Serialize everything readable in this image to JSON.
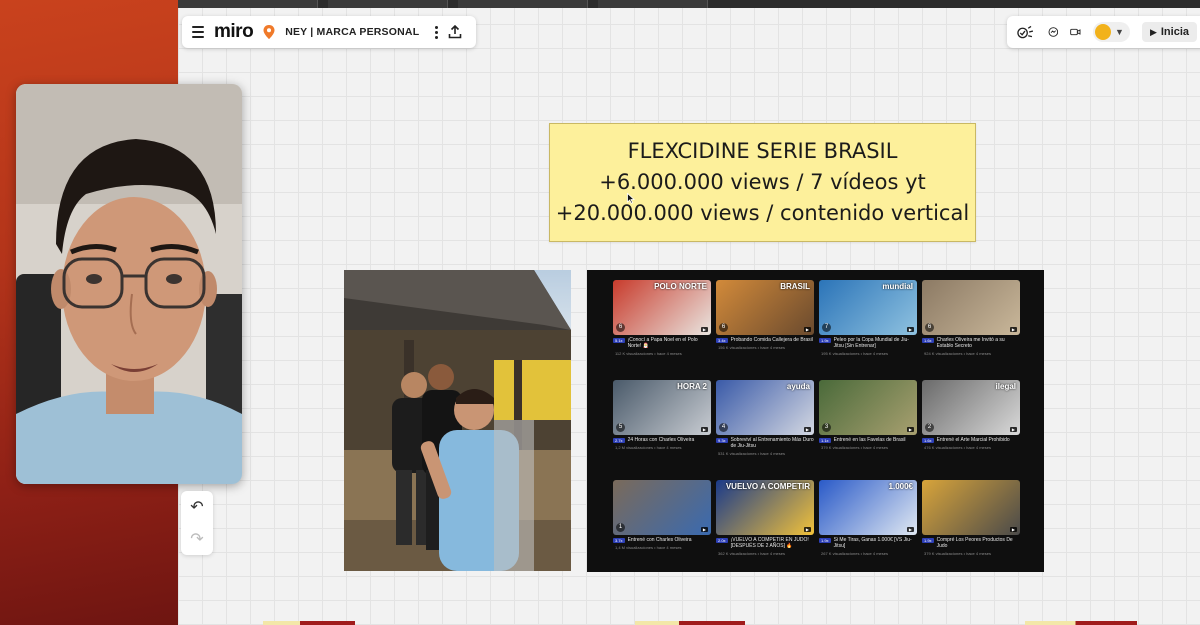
{
  "toolbar": {
    "logo": "miro",
    "board_name": "NEY | MARCA PERSONAL",
    "icons": [
      "menu-icon",
      "location-pin-icon",
      "more-vertical-icon",
      "upload-icon"
    ]
  },
  "right_toolbar": {
    "start_label": "Inicia",
    "icons": [
      "reactions-icon",
      "chat-icon",
      "video-icon",
      "collaborator-avatar",
      "chevron-down-icon",
      "play-icon"
    ],
    "avatar_color": "#f2b21b"
  },
  "sticky": {
    "line1": "FLEXCIDINE SERIE BRASIL",
    "line2": "+6.000.000 views / 7 vídeos yt",
    "line3": "+20.000.000 views / contenido vertical",
    "color": "#fdf09b"
  },
  "videos": [
    {
      "badge": "5.1x",
      "title": "¡Conocí a Papa Noel en el Polo Norte! 🎅",
      "sub": "112 K visualizaciones • hace 4 meses",
      "word": "POLO NORTE",
      "num": "6"
    },
    {
      "badge": "3.4x",
      "title": "Probando Comida Callejera de Brasil",
      "sub": "156 K visualizaciones • hace 4 meses",
      "word": "BRASIL",
      "num": "6"
    },
    {
      "badge": "1.9x",
      "title": "Peleo por la Copa Mundial de Jiu-Jitsu [Sin Entrenar]",
      "sub": "195 K visualizaciones • hace 4 meses",
      "word": "mundial",
      "num": "7"
    },
    {
      "badge": "1.6x",
      "title": "Charles Oliveira me Invitó a su Establo Secreto",
      "sub": "924 K visualizaciones • hace 4 meses",
      "word": "",
      "num": "6"
    },
    {
      "badge": "2.7x",
      "title": "24 Horas con Charles Oliveira",
      "sub": "1,2 M visualizaciones • hace 4 meses",
      "word": "HORA 2",
      "num": "5"
    },
    {
      "badge": "9.3x",
      "title": "Sobreviví al Entrenamiento Más Duro de Jiu-Jitsu",
      "sub": "531 K visualizaciones • hace 4 meses",
      "word": "ayuda",
      "num": "4"
    },
    {
      "badge": "1.1x",
      "title": "Entrené en las Favelas de Brasil",
      "sub": "379 K visualizaciones • hace 4 meses",
      "word": "",
      "num": "3"
    },
    {
      "badge": "1.6x",
      "title": "Entrené el Arte Marcial Prohibido",
      "sub": "476 K visualizaciones • hace 4 meses",
      "word": "ilegal",
      "num": "2"
    },
    {
      "badge": "3.7x",
      "title": "Entrené con Charles Oliveira",
      "sub": "1,4 M visualizaciones • hace 4 meses",
      "word": "",
      "num": "1"
    },
    {
      "badge": "2.0x",
      "title": "¡VUELVO A COMPETIR EN JUDO! [DESPUÉS DE 2 AÑOS] 🔥",
      "sub": "362 K visualizaciones • hace 4 meses",
      "word": "VUELVO A COMPETIR",
      "num": ""
    },
    {
      "badge": "1.9x",
      "title": "Si Me Tiras, Ganas 1.000€ [VS Jiu-Jitsu]",
      "sub": "267 K visualizaciones • hace 4 meses",
      "word": "1.000€",
      "num": ""
    },
    {
      "badge": "1.9x",
      "title": "Compré Los Peores Productos De Judo",
      "sub": "379 K visualizaciones • hace 4 meses",
      "word": "",
      "num": ""
    }
  ],
  "undo": {
    "icons": [
      "undo-icon",
      "redo-icon"
    ]
  }
}
